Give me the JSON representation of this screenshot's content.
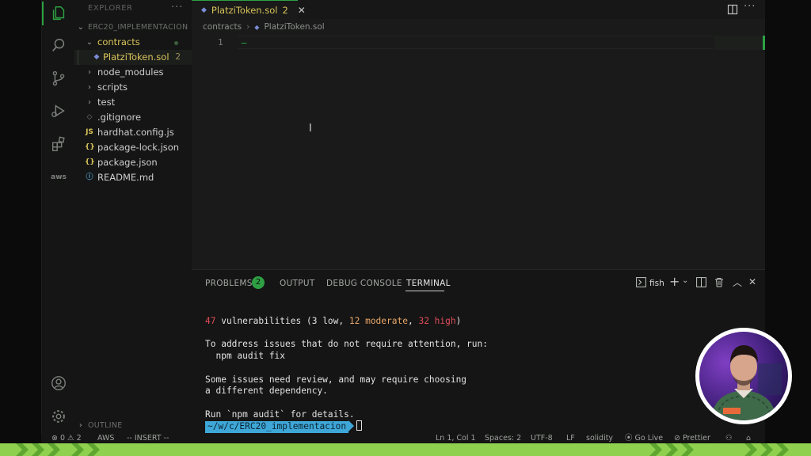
{
  "sidebar": {
    "title": "EXPLORER",
    "more": "···",
    "project": "ERC20_IMPLEMENTACION",
    "items": [
      {
        "label": "contracts",
        "kind": "folder-open",
        "level": 1
      },
      {
        "label": "PlatziToken.sol",
        "kind": "solidity-file",
        "level": 2,
        "badge": "2"
      },
      {
        "label": "node_modules",
        "kind": "folder",
        "level": 1
      },
      {
        "label": "scripts",
        "kind": "folder",
        "level": 1
      },
      {
        "label": "test",
        "kind": "folder",
        "level": 1
      },
      {
        "label": ".gitignore",
        "kind": "git-file",
        "level": 1
      },
      {
        "label": "hardhat.config.js",
        "kind": "js-file",
        "level": 1,
        "icon_text": "JS"
      },
      {
        "label": "package-lock.json",
        "kind": "json-file",
        "level": 1,
        "icon_text": "{}"
      },
      {
        "label": "package.json",
        "kind": "json-file",
        "level": 1,
        "icon_text": "{}"
      },
      {
        "label": "README.md",
        "kind": "info-file",
        "level": 1
      }
    ],
    "outline": "OUTLINE"
  },
  "activity_bar": {
    "items": [
      "files-icon",
      "search-icon",
      "source-control-icon",
      "run-debug-icon",
      "extensions-icon",
      "aws-icon"
    ],
    "aws_label": "aws",
    "bottom": [
      "account-icon",
      "settings-gear-icon"
    ]
  },
  "editor": {
    "tab": {
      "name": "PlatziToken.sol",
      "count": "2",
      "close": "✕"
    },
    "more": "···",
    "breadcrumb": [
      "contracts",
      "PlatziToken.sol"
    ],
    "line_number": "1",
    "text_cursor": "I"
  },
  "panel": {
    "tabs": [
      "PROBLEMS",
      "OUTPUT",
      "DEBUG CONSOLE",
      "TERMINAL"
    ],
    "problems_count": "2",
    "shell": "fish",
    "terminal": {
      "vuln_count": "47",
      "vuln_text_a": " vulnerabilities (3 low, ",
      "vuln_moderate": "12 moderate",
      "vuln_text_b": ", ",
      "vuln_high": "32 high",
      "vuln_text_c": ")",
      "line2": "To address issues that do not require attention, run:",
      "line3": "  npm audit fix",
      "line4": "Some issues need review, and may require choosing",
      "line5": "a different dependency.",
      "line6": "Run `npm audit` for details.",
      "prompt_path": "~/w/c/ERC20_implementacion"
    }
  },
  "status_bar": {
    "errors": "⊗ 0 ⚠ 2",
    "aws": "AWS",
    "mode": "-- INSERT --",
    "position": "Ln 1, Col 1",
    "spaces": "Spaces: 2",
    "encoding": "UTF-8",
    "eol": "LF",
    "language": "solidity",
    "golive": "Go Live",
    "prettier": "Prettier"
  },
  "colors": {
    "accent": "#2ea043",
    "warning_yellow": "#d9c45a",
    "prompt_blue": "#3ea7d8",
    "band_green": "#8fd14f"
  }
}
